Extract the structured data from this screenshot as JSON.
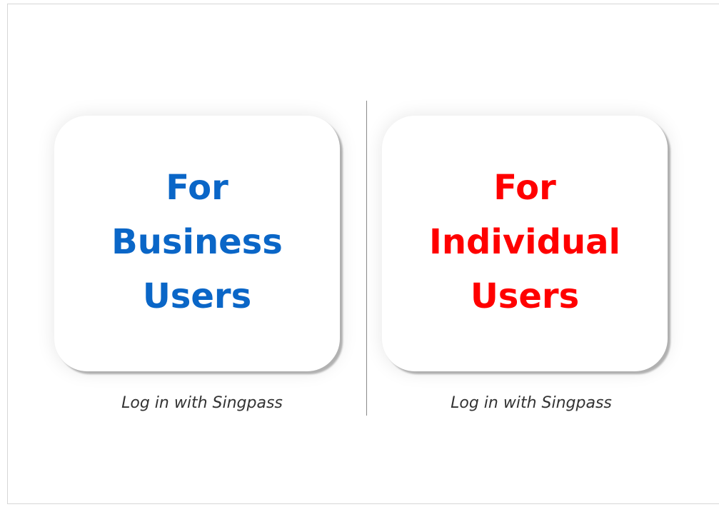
{
  "business_card": {
    "lines": [
      "For",
      "Business",
      "Users"
    ],
    "caption": "Log in with Singpass",
    "color": "#0a66c7"
  },
  "individual_card": {
    "lines": [
      "For",
      "Individual",
      "Users"
    ],
    "caption": "Log in with Singpass",
    "color": "#ff0000"
  }
}
